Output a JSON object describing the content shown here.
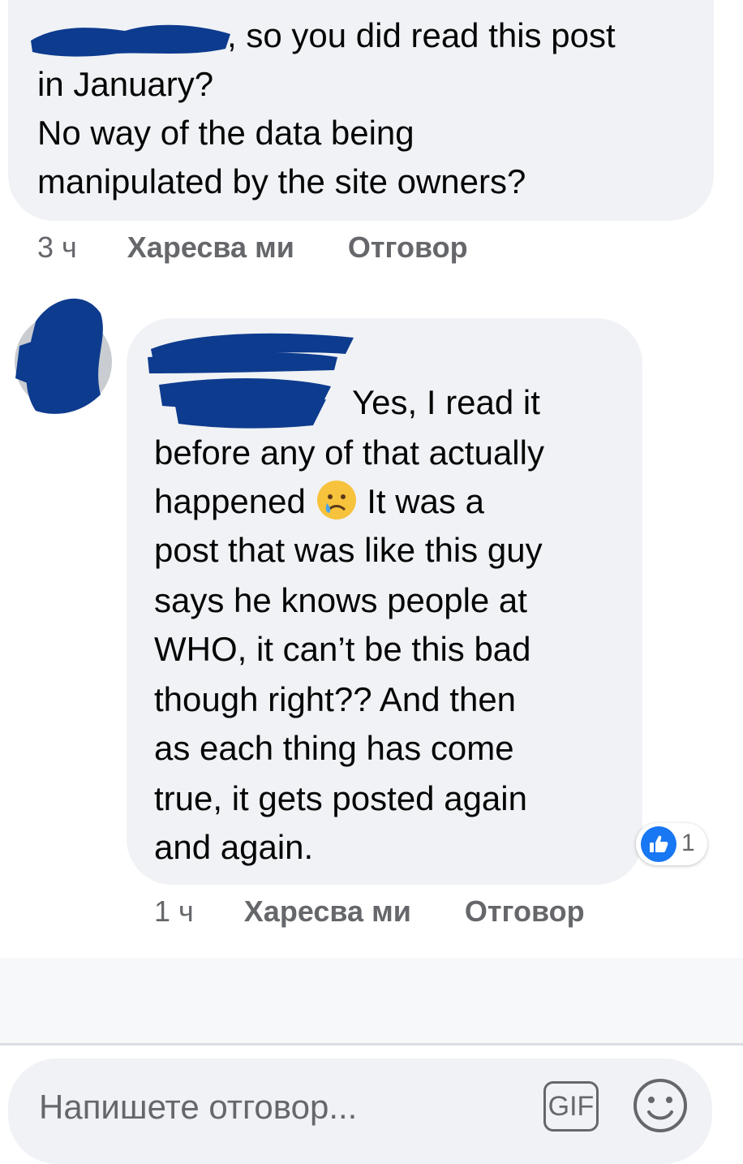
{
  "comment1": {
    "lines": [
      ", so you did read this post",
      "in January?",
      "No way of the data being",
      "manipulated by the site owners?"
    ],
    "time": "3 ч",
    "like_label": "Харесва ми",
    "reply_label": "Отговор"
  },
  "comment2": {
    "first_line": "Yes, I read it",
    "line2": "before any of that actually",
    "line3_before": "happened",
    "line3_after": "It was a",
    "lines_rest": [
      "post that was like this guy",
      "says he knows people at",
      "WHO, it can’t be this bad",
      "though right?? And then",
      "as each thing has come",
      "true, it gets posted again",
      "and again."
    ],
    "time": "1 ч",
    "like_label": "Харесва ми",
    "reply_label": "Отговор",
    "reaction": {
      "icon": "thumbs-up-icon",
      "count": "1",
      "color": "#1877f2"
    }
  },
  "composer": {
    "placeholder": "Напишете отговор...",
    "gif_label": "GIF",
    "emoji_icon": "smiley-icon"
  },
  "colors": {
    "bubble": "#f0f2f5",
    "meta_text": "#65676b",
    "redaction": "#0d3b8e",
    "like_blue": "#1877f2"
  }
}
